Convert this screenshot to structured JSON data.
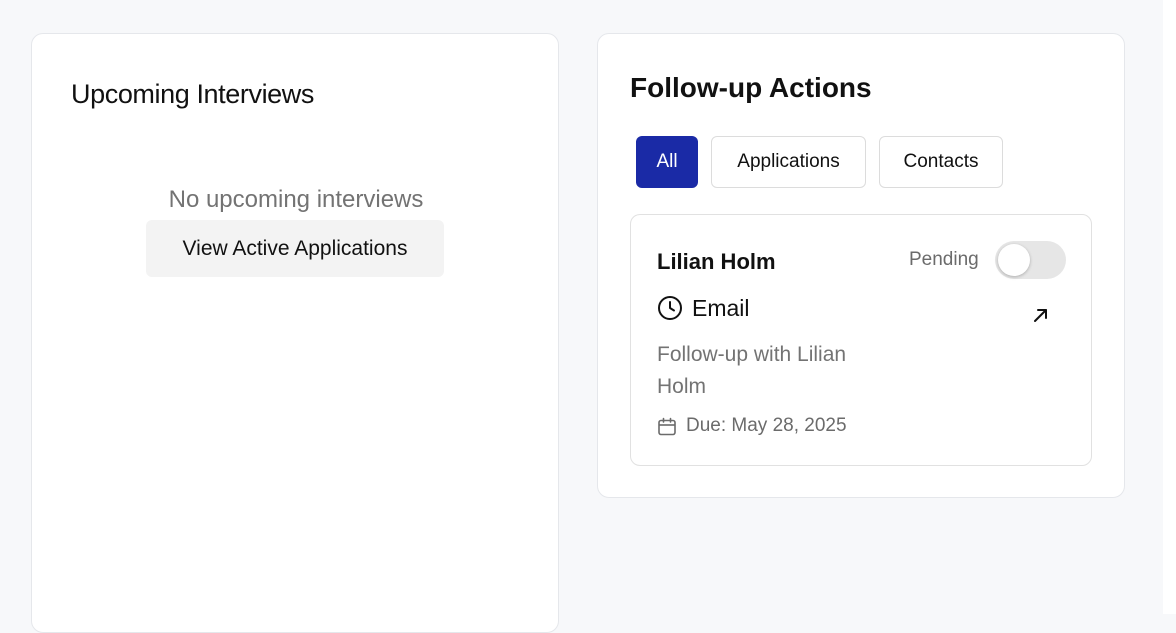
{
  "upcoming_interviews": {
    "title": "Upcoming Interviews",
    "empty_message": "No upcoming interviews",
    "view_button_label": "View Active Applications"
  },
  "follow_up": {
    "title": "Follow-up Actions",
    "tabs": [
      {
        "label": "All",
        "active": true
      },
      {
        "label": "Applications",
        "active": false
      },
      {
        "label": "Contacts",
        "active": false
      }
    ],
    "items": [
      {
        "name": "Lilian Holm",
        "status": "Pending",
        "completed": false,
        "method_icon": "clock-icon",
        "method": "Email",
        "description": "Follow-up with Lilian Holm",
        "due_icon": "calendar-icon",
        "due": "Due: May 28, 2025",
        "link_icon": "arrow-up-right-icon"
      }
    ]
  },
  "colors": {
    "accent": "#1a2aa6",
    "page_background": "#f7f8fa",
    "muted_text": "#737373"
  }
}
